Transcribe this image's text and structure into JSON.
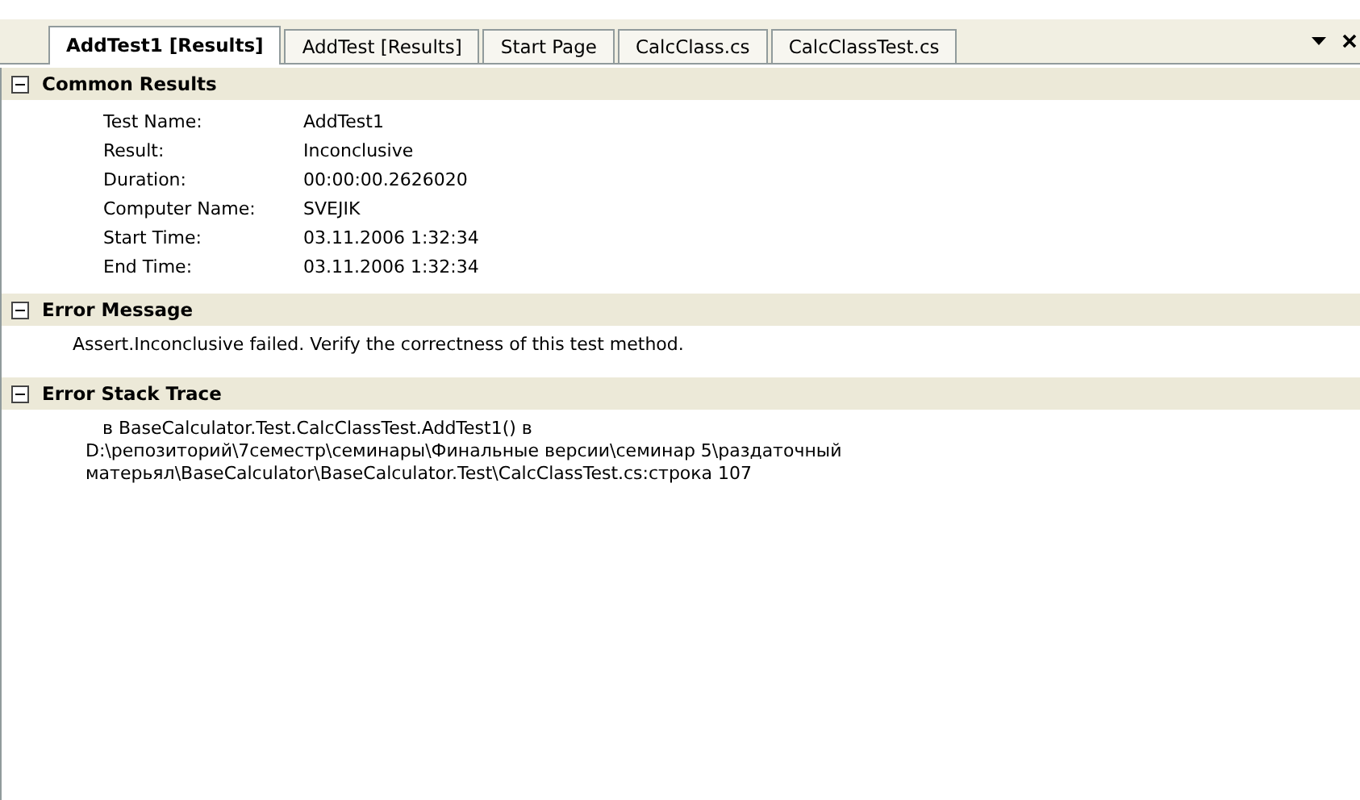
{
  "tabs": [
    {
      "label": "AddTest1 [Results]",
      "selected": true
    },
    {
      "label": "AddTest [Results]",
      "selected": false
    },
    {
      "label": "Start Page",
      "selected": false
    },
    {
      "label": "CalcClass.cs",
      "selected": false
    },
    {
      "label": "CalcClassTest.cs",
      "selected": false
    }
  ],
  "sections": [
    {
      "title": "Common Results",
      "expanded": true,
      "kind": "fields",
      "fields": [
        {
          "label": "Test Name:",
          "value": "AddTest1"
        },
        {
          "label": "Result:",
          "value": "Inconclusive"
        },
        {
          "label": "Duration:",
          "value": "00:00:00.2626020"
        },
        {
          "label": "Computer Name:",
          "value": "SVEJIK"
        },
        {
          "label": "Start Time:",
          "value": "03.11.2006 1:32:34"
        },
        {
          "label": "End Time:",
          "value": "03.11.2006 1:32:34"
        }
      ]
    },
    {
      "title": "Error Message",
      "expanded": true,
      "kind": "text",
      "lines": [
        "Assert.Inconclusive failed. Verify the correctness of this test method."
      ]
    },
    {
      "title": "Error Stack Trace",
      "expanded": true,
      "kind": "text",
      "lines": [
        "   в BaseCalculator.Test.CalcClassTest.AddTest1() в",
        "D:\\репозиторий\\7семестр\\семинары\\Финальные версии\\семинар 5\\раздаточный",
        "матерьял\\BaseCalculator\\BaseCalculator.Test\\CalcClassTest.cs:строка 107"
      ]
    }
  ]
}
